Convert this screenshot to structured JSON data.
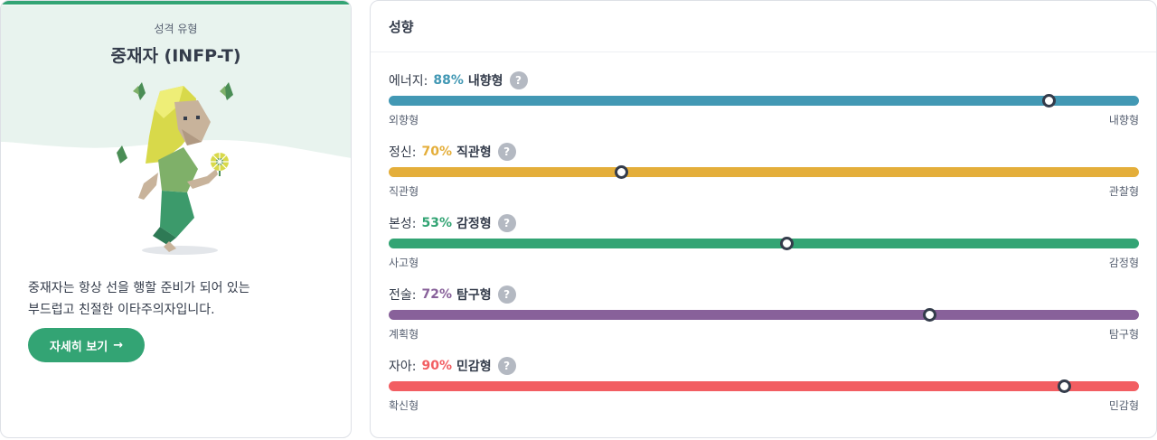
{
  "summary": {
    "label": "성격 유형",
    "title": "중재자 (INFP-T)",
    "description_line1": "중재자는 항상 선을 행할 준비가 되어 있는",
    "description_line2": "부드럽고 친절한 이타주의자입니다.",
    "more_button": "자세히 보기",
    "more_arrow": "→",
    "accent_color": "#33a474"
  },
  "traits_panel": {
    "title": "성향",
    "help_glyph": "?",
    "traits": [
      {
        "category": "에너지:",
        "percent": "88%",
        "percent_value": 0.88,
        "type": "내향형",
        "left": "외향형",
        "right": "내향형",
        "color": "#4298b4"
      },
      {
        "category": "정신:",
        "percent": "70%",
        "percent_value": 0.31,
        "type": "직관형",
        "left": "직관형",
        "right": "관찰형",
        "color": "#e4ae3a"
      },
      {
        "category": "본성:",
        "percent": "53%",
        "percent_value": 0.53,
        "type": "감정형",
        "left": "사고형",
        "right": "감정형",
        "color": "#33a474"
      },
      {
        "category": "전술:",
        "percent": "72%",
        "percent_value": 0.72,
        "type": "탐구형",
        "left": "계획형",
        "right": "탐구형",
        "color": "#88619a"
      },
      {
        "category": "자아:",
        "percent": "90%",
        "percent_value": 0.9,
        "type": "민감형",
        "left": "확신형",
        "right": "민감형",
        "color": "#f25e62"
      }
    ]
  }
}
